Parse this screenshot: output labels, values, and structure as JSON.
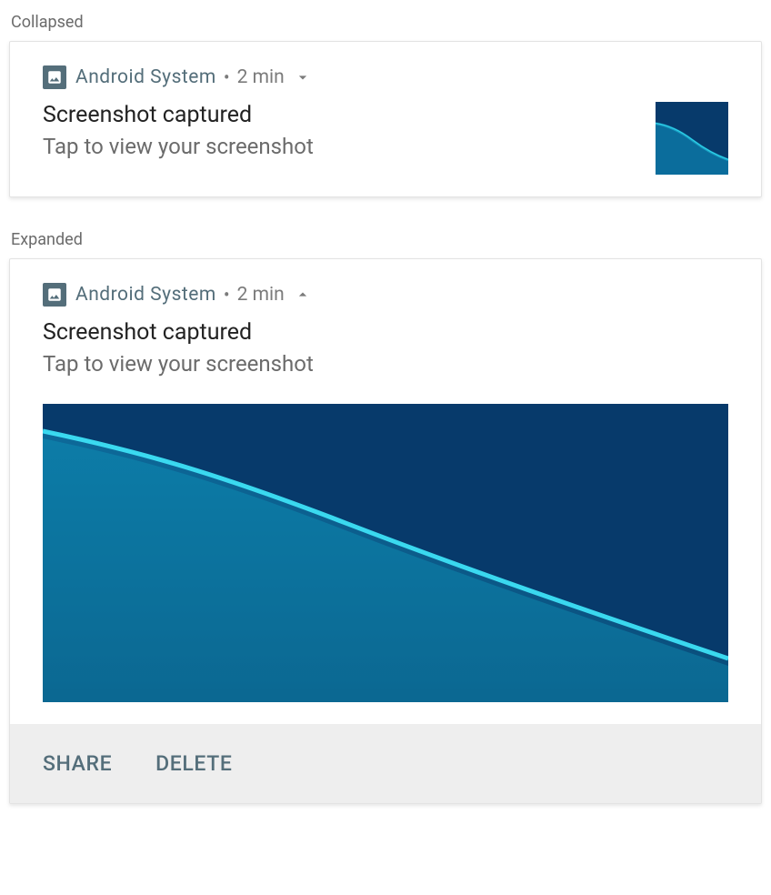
{
  "labels": {
    "collapsed": "Collapsed",
    "expanded": "Expanded"
  },
  "notification": {
    "app_name": "Android  System",
    "separator": "•",
    "time": "2 min",
    "title": "Screenshot captured",
    "subtitle": "Tap to view your screenshot"
  },
  "actions": {
    "share": "SHARE",
    "delete": "DELETE"
  },
  "colors": {
    "accent": "#546e7a",
    "image_bg": "#073a6b",
    "image_wave": "#0fa0c4"
  }
}
